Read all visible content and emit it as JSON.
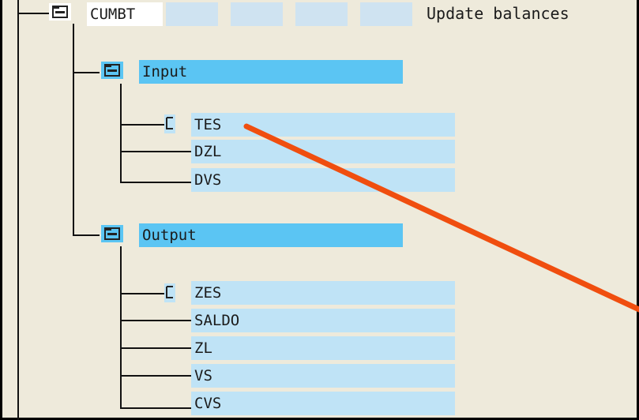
{
  "tree": {
    "root": {
      "label": "CUMBT",
      "description": "Update balances"
    },
    "groups": [
      {
        "key": "input",
        "label": "Input",
        "fields": [
          "TES",
          "DZL",
          "DVS"
        ]
      },
      {
        "key": "output",
        "label": "Output",
        "fields": [
          "ZES",
          "SALDO",
          "ZL",
          "VS",
          "CVS"
        ]
      }
    ]
  },
  "annotation": {
    "arrow_color": "#f04e0f"
  },
  "colors": {
    "background": "#eeeadb",
    "node_highlight": "#5bc5f3",
    "field_highlight": "#bfe3f6",
    "lines": "#111111"
  },
  "icons": {
    "root": "folder-icon",
    "groups": "folder-icon",
    "first_field": "document-icon"
  }
}
